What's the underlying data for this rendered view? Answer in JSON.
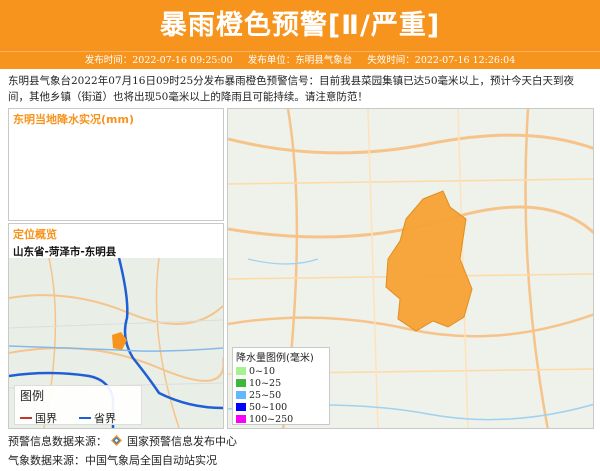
{
  "header": {
    "title": "暴雨橙色预警[Ⅱ/严重]",
    "publish_time": "发布时间：2022-07-16 09:25:00",
    "publisher": "发布单位：东明县气象台",
    "expire_time": "失效时间：2022-07-16 12:26:04",
    "bg_color": "#f7941d"
  },
  "description": "东明县气象台2022年07月16日09时25分发布暴雨橙色预警信号：目前我县菜园集镇已达50毫米以上，预计今天白天到夜间，其他乡镇（街道）也将出现50毫米以上的降雨且可能持续。请注意防范！",
  "rain_panel": {
    "title": "东明当地降水实况(mm)"
  },
  "location_panel": {
    "title": "定位概览",
    "path": "山东省-菏泽市-东明县",
    "legend_title": "图例",
    "legend_items": [
      {
        "label": "国界",
        "color": "#c0392b"
      },
      {
        "label": "省界",
        "color": "#1f5fd6"
      }
    ]
  },
  "rain_legend": {
    "title": "降水量图例(毫米)",
    "items": [
      {
        "label": "0~10",
        "color": "#a6f28f"
      },
      {
        "label": "10~25",
        "color": "#3db83d"
      },
      {
        "label": "25~50",
        "color": "#61b8ff"
      },
      {
        "label": "50~100",
        "color": "#0000ff"
      },
      {
        "label": "100~250",
        "color": "#fa00fa"
      }
    ]
  },
  "footer": {
    "warn_source": "预警信息数据来源：",
    "warn_source_name": "国家预警信息发布中心",
    "obs_source": "气象数据来源：中国气象局全国自动站实况"
  }
}
